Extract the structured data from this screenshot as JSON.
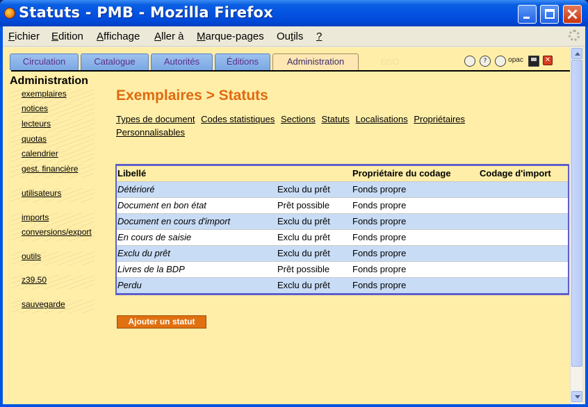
{
  "window": {
    "title": "Statuts - PMB - Mozilla Firefox"
  },
  "menubar": {
    "items": [
      {
        "acc": "F",
        "rest": "ichier"
      },
      {
        "acc": "E",
        "rest": "dition"
      },
      {
        "acc": "A",
        "rest": "ffichage"
      },
      {
        "acc": "A",
        "rest": "ller à"
      },
      {
        "acc": "M",
        "rest": "arque-pages"
      },
      {
        "pre": "Ou",
        "acc": "t",
        "rest": "ils"
      },
      {
        "acc": "?",
        "rest": ""
      }
    ]
  },
  "tabs": [
    {
      "label": "Circulation"
    },
    {
      "label": "Catalogue"
    },
    {
      "label": "Autorités"
    },
    {
      "label": "Éditions"
    },
    {
      "label": "Administration",
      "active": true
    }
  ],
  "tab_ghost": "DSO",
  "toolbar_icons": {
    "opac_label": "opac",
    "help_label": "?",
    "close_label": "✕"
  },
  "nav": {
    "title": "Administration",
    "items": [
      {
        "label": "exemplaires"
      },
      {
        "label": "notices"
      },
      {
        "label": "lecteurs"
      },
      {
        "label": "quotas"
      },
      {
        "label": "calendrier"
      },
      {
        "label": "gest. financière"
      },
      {
        "label": "utilisateurs"
      },
      {
        "label": "imports"
      },
      {
        "label": "conversions/export"
      },
      {
        "label": "outils"
      },
      {
        "label": "z39.50"
      },
      {
        "label": "sauvegarde"
      }
    ]
  },
  "main": {
    "title": "Exemplaires > Statuts",
    "sublinks": [
      "Types de document",
      "Codes statistiques",
      "Sections",
      "Statuts",
      "Localisations",
      "Propriétaires",
      "Personnalisables"
    ],
    "table": {
      "headers": [
        "Libellé",
        "",
        "Propriétaire du codage",
        "Codage d'import"
      ],
      "rows": [
        [
          "Détérioré",
          "Exclu du prêt",
          "Fonds propre",
          ""
        ],
        [
          "Document en bon état",
          "Prêt possible",
          "Fonds propre",
          ""
        ],
        [
          "Document en cours d'import",
          "Exclu du prêt",
          "Fonds propre",
          ""
        ],
        [
          "En cours de saisie",
          "Exclu du prêt",
          "Fonds propre",
          ""
        ],
        [
          "Exclu du prêt",
          "Exclu du prêt",
          "Fonds propre",
          ""
        ],
        [
          "Livres de la BDP",
          "Prêt possible",
          "Fonds propre",
          ""
        ],
        [
          "Perdu",
          "Exclu du prêt",
          "Fonds propre",
          ""
        ]
      ]
    },
    "add_button": "Ajouter un statut"
  }
}
